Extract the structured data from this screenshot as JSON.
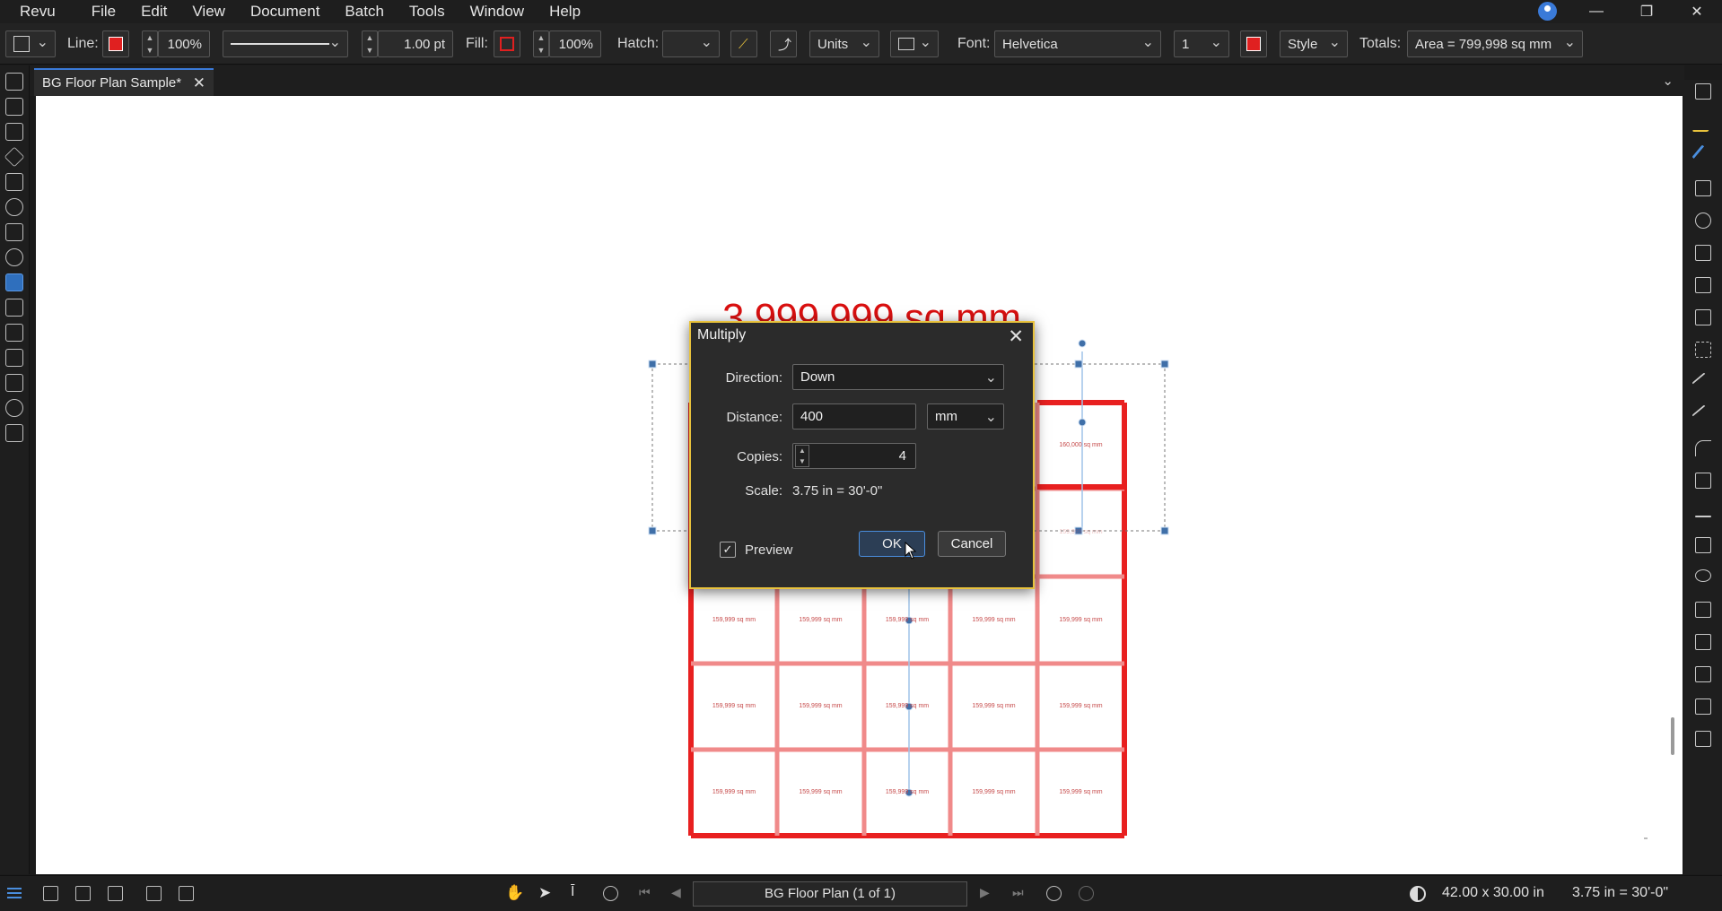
{
  "app": {
    "name": "Revu",
    "menu": [
      "File",
      "Edit",
      "View",
      "Document",
      "Batch",
      "Tools",
      "Window",
      "Help"
    ],
    "window_controls": [
      "—",
      "❐",
      "✕"
    ]
  },
  "toolbar": {
    "line_label": "Line:",
    "line_color": "#e02020",
    "line_opacity": "100%",
    "line_width": "1.00 pt",
    "fill_label": "Fill:",
    "fill_opacity": "100%",
    "hatch_label": "Hatch:",
    "units_label": "Units",
    "font_label": "Font:",
    "font_value": "Helvetica",
    "font_size": "1",
    "style_label": "Style",
    "totals_label": "Totals:",
    "totals_value": "Area = 799,998 sq mm"
  },
  "tab": {
    "label": "BG Floor Plan Sample*"
  },
  "drawing": {
    "big_total": "3,999,999 sq mm",
    "top_cell_label": "160,000 sq mm",
    "cell_label": "159,999 sq mm",
    "grid_cols": 5,
    "grid_rows": 5,
    "line_color": "#e82020",
    "faded_color": "#f08a8a"
  },
  "dialog": {
    "title": "Multiply",
    "direction_label": "Direction:",
    "direction_value": "Down",
    "distance_label": "Distance:",
    "distance_value": "400",
    "distance_unit": "mm",
    "copies_label": "Copies:",
    "copies_value": "4",
    "scale_label": "Scale:",
    "scale_value": "3.75 in = 30'-0\"",
    "preview_label": "Preview",
    "preview_checked": true,
    "ok_label": "OK",
    "cancel_label": "Cancel"
  },
  "status": {
    "page": "BG Floor Plan (1 of 1)",
    "page_size": "42.00 x 30.00 in",
    "scale": "3.75 in = 30'-0\""
  }
}
